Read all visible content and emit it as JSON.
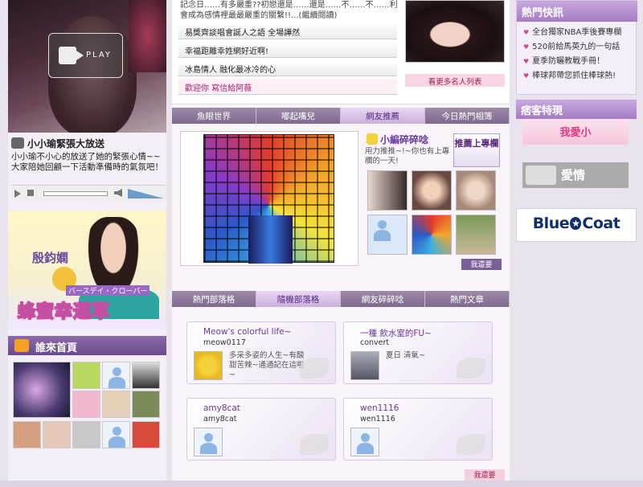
{
  "video": {
    "play_label": "PLAY",
    "title": "小小瑜緊張大放送",
    "description": "小小瑜不小心的放送了她的緊張心情~~大家陪她回顧一下活動準備時的氣氛吧！"
  },
  "ad_banner": {
    "name": "殷鈞嫻",
    "subtitle": "バースデイ・クローバー",
    "tagline": "蜂蜜幸運草"
  },
  "who_visited": {
    "title": "誰來首頁"
  },
  "top_news": {
    "intro": "記念日……有多嚴重??初戀還是……還是……不……不……利會成為感情裡最最嚴重的關繫!!...(繼續閱讀)",
    "items": [
      "易獎齊談唱會誕人之語 全場譁然",
      "幸福距離幸姓網好近啊!",
      "冰島情人 融化最冰冷的心",
      "歡迎你 寫信給阿薇"
    ],
    "more_button": "看更多名人列表"
  },
  "tabs_top": [
    "魚眼世界",
    "嘟起嘴兒",
    "網友推薦",
    "今日熱門相簿"
  ],
  "tabs_top_active": 2,
  "editor": {
    "title": "小編碎碎唸",
    "description": "用力推推~!~你也有上專欄的一天!",
    "recommend_button": "推薦上專欄",
    "mine_button": "我還要"
  },
  "tabs_bottom": [
    "熱門部落格",
    "隨機部落格",
    "網友碎碎唸",
    "熱門文章"
  ],
  "tabs_bottom_active": 1,
  "blogs": [
    {
      "title": "Meow's colorful life~",
      "user": "meow0117",
      "desc": "多采多姿的人生~有酸甜苦辣~通通記在這啦~"
    },
    {
      "title": "一種 飲水室的FU~",
      "user": "convert",
      "desc": "夏日 清氣~"
    },
    {
      "title": "amy8cat",
      "user": "amy8cat",
      "desc": ""
    },
    {
      "title": "wen1116",
      "user": "wen1116",
      "desc": ""
    }
  ],
  "blogs_more": "我還要",
  "hot_news": {
    "title": "熱門快訊",
    "items": [
      "全台獨家NBA季後賽專欄",
      "520前給馬英九的一句話",
      "夏季防曬教戰手冊！",
      "棒球邦帶您抓住棒球熱!"
    ]
  },
  "features": {
    "title": "痞客特現",
    "item1": "我愛小",
    "item2": "愛情"
  },
  "sponsor": {
    "left": "Blue",
    "right": "Coat"
  },
  "colors": {
    "accent_purple": "#7a5e98",
    "tab_active": "#c8b0dc",
    "pink": "#d04a8a",
    "bluecoat": "#11306a"
  }
}
